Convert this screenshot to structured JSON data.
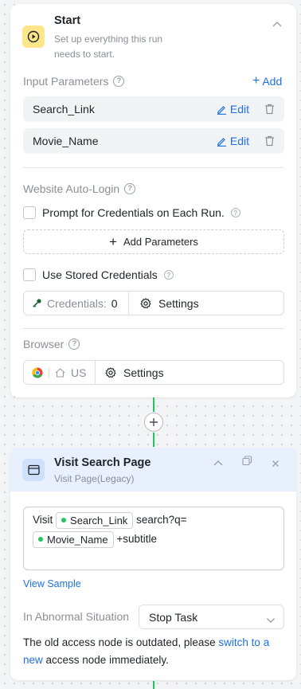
{
  "start": {
    "title": "Start",
    "subtitle": "Set up everything this run needs to start.",
    "input_parameters": {
      "label": "Input Parameters",
      "add_label": "Add",
      "items": [
        {
          "name": "Search_Link",
          "edit_label": "Edit"
        },
        {
          "name": "Movie_Name",
          "edit_label": "Edit"
        }
      ]
    },
    "auto_login": {
      "label": "Website Auto-Login",
      "prompt_checkbox_label": "Prompt for Credentials on Each Run.",
      "add_parameters_label": "Add Parameters",
      "stored_checkbox_label": "Use Stored Credentials",
      "credentials_label": "Credentials:",
      "credentials_count": "0",
      "settings_label": "Settings"
    },
    "browser": {
      "label": "Browser",
      "region": "US",
      "settings_label": "Settings"
    }
  },
  "visit": {
    "title": "Visit Search Page",
    "subtitle": "Visit Page(Legacy)",
    "url_parts": {
      "prefix": "Visit",
      "chip1": "Search_Link",
      "middle": "search?q=",
      "chip2": "Movie_Name",
      "suffix": "+subtitle"
    },
    "view_sample": "View Sample",
    "abnormal_label": "In Abnormal Situation",
    "abnormal_value": "Stop Task",
    "note_before": "The old access node is outdated, please ",
    "note_link": "switch to a new",
    "note_after": " access node immediately."
  },
  "colors": {
    "accent": "#1e6fe8",
    "start_icon_bg": "#fde68a",
    "connector": "#22c55e",
    "visit_header_bg": "#e8f0fd"
  }
}
